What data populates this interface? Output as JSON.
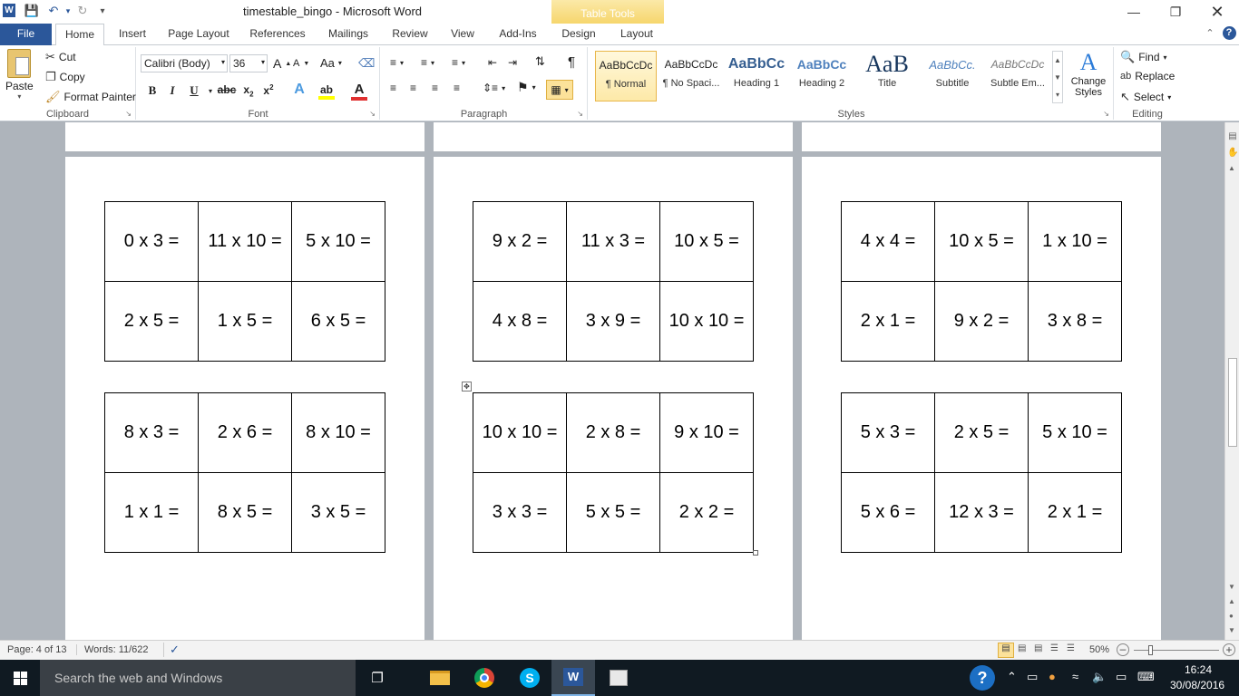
{
  "titlebar": {
    "document_title": "timestable_bingo  -  Microsoft Word",
    "contextual_tab_group": "Table Tools"
  },
  "tabs": [
    "File",
    "Home",
    "Insert",
    "Page Layout",
    "References",
    "Mailings",
    "Review",
    "View",
    "Add-Ins",
    "Design",
    "Layout"
  ],
  "clipboard": {
    "label": "Clipboard",
    "paste": "Paste",
    "cut": "Cut",
    "copy": "Copy",
    "format_painter": "Format Painter"
  },
  "font": {
    "label": "Font",
    "name": "Calibri (Body)",
    "size": "36"
  },
  "paragraph": {
    "label": "Paragraph"
  },
  "styles": {
    "label": "Styles",
    "items": [
      {
        "preview": "AaBbCcDc",
        "name": "¶ Normal"
      },
      {
        "preview": "AaBbCcDc",
        "name": "¶ No Spaci..."
      },
      {
        "preview": "AaBbCc",
        "name": "Heading 1"
      },
      {
        "preview": "AaBbCc",
        "name": "Heading 2"
      },
      {
        "preview": "AaB",
        "name": "Title"
      },
      {
        "preview": "AaBbCc.",
        "name": "Subtitle"
      },
      {
        "preview": "AaBbCcDc",
        "name": "Subtle Em..."
      }
    ],
    "change_styles": "Change Styles"
  },
  "editing": {
    "label": "Editing",
    "find": "Find",
    "replace": "Replace",
    "select": "Select"
  },
  "tables": [
    {
      "rows": [
        [
          "0 x 3 =",
          "11 x 10 =",
          "5 x 10 ="
        ],
        [
          "2 x 5 =",
          "1 x 5 =",
          "6 x 5 ="
        ]
      ]
    },
    {
      "rows": [
        [
          "9 x 2 =",
          "11 x 3 =",
          "10 x 5 ="
        ],
        [
          "4 x 8 =",
          "3 x 9 =",
          "10 x 10 ="
        ]
      ]
    },
    {
      "rows": [
        [
          "4 x 4 =",
          "10 x 5 =",
          "1 x 10 ="
        ],
        [
          "2 x 1 =",
          "9 x 2 =",
          "3 x 8 ="
        ]
      ]
    },
    {
      "rows": [
        [
          "8 x 3 =",
          "2 x 6 =",
          "8 x 10 ="
        ],
        [
          "1 x 1 =",
          "8 x 5 =",
          "3 x 5 ="
        ]
      ]
    },
    {
      "rows": [
        [
          "10 x 10 =",
          "2 x 8 =",
          "9 x 10 ="
        ],
        [
          "3 x 3 =",
          "5 x 5 =",
          "2 x 2 ="
        ]
      ]
    },
    {
      "rows": [
        [
          "5 x 3 =",
          "2 x 5 =",
          "5 x 10 ="
        ],
        [
          "5 x 6 =",
          "12 x 3 =",
          "2 x 1 ="
        ]
      ]
    }
  ],
  "statusbar": {
    "page": "Page: 4 of 13",
    "words": "Words: 11/622",
    "zoom": "50%"
  },
  "taskbar": {
    "search_placeholder": "Search the web and Windows",
    "time": "16:24",
    "date": "30/08/2016"
  },
  "colors": {
    "accent": "#2b579a",
    "table_tools": "#f6d56a",
    "taskbar": "#101a22"
  }
}
